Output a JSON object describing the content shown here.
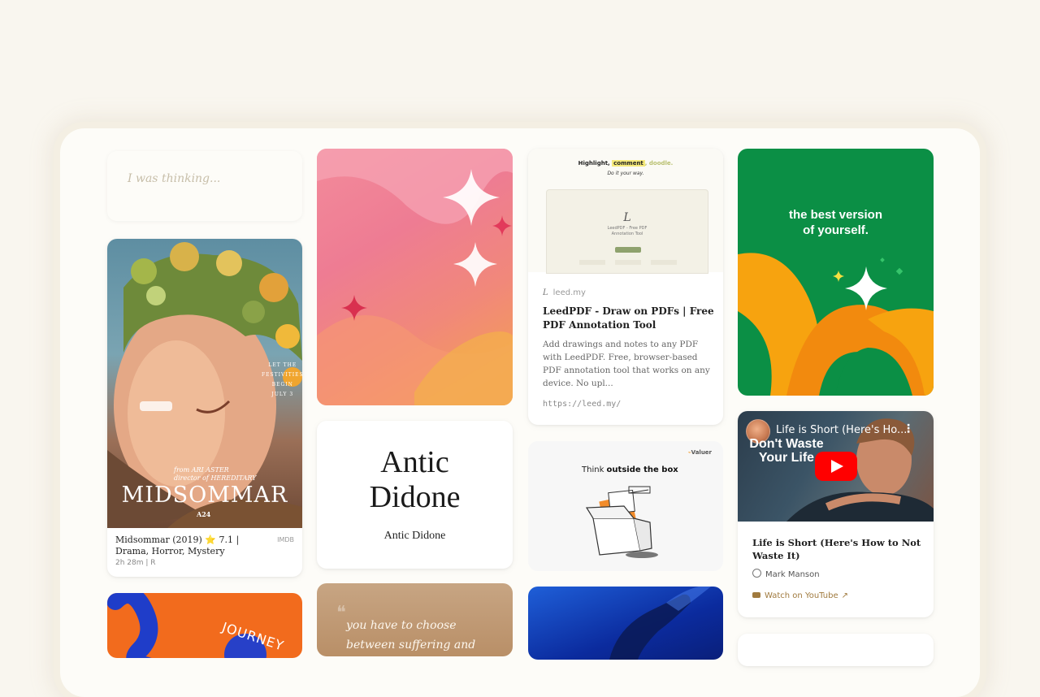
{
  "note": {
    "placeholder": "I was thinking..."
  },
  "movie": {
    "poster_title": "MIDSOMMAR",
    "poster_credit": "from ARI ASTER\ndirector of HEREDITARY",
    "poster_dates": "LET THE\nFESTIVITIES\nBEGIN\nJULY 3",
    "poster_studio": "A24",
    "title_line": "Midsommar (2019) ⭐ 7.1 | Drama, Horror, Mystery",
    "sub_line": "2h 28m | R",
    "source": "IMDB"
  },
  "font_card": {
    "display_text": "Antic\nDidone",
    "name": "Antic Didone"
  },
  "quote": {
    "text": "you have to choose\nbetween suffering and"
  },
  "link_card": {
    "preview_headline_prefix": "Highlight, ",
    "preview_headline_highlight": "comment",
    "preview_headline_suffix": ", doodle.",
    "preview_subline": "Do it your way.",
    "preview_logo": "L",
    "preview_app_title": "LeedPDF - Free PDF\nAnnotation Tool",
    "domain": "leed.my",
    "domain_icon": "L",
    "title": "LeedPDF - Draw on PDFs | Free PDF Annotation Tool",
    "description": "Add drawings and notes to any PDF with LeedPDF. Free, browser-based PDF annotation tool that works on any device. No upl...",
    "url": "https://leed.my/"
  },
  "think_card": {
    "brand": "Valuer",
    "text_prefix": "Think ",
    "text_bold": "outside the box"
  },
  "green_card": {
    "headline": "the best version\nof yourself."
  },
  "video_card": {
    "thumb_title": "Life is Short (Here's Ho...",
    "thumb_caption": "Don't Waste\nYour Life",
    "title": "Life is Short (Here's How to Not Waste It)",
    "author": "Mark Manson",
    "watch_label": "Watch on YouTube",
    "icons": [
      "more-vert-icon",
      "play-icon",
      "person-icon",
      "youtube-icon",
      "external-link-icon"
    ]
  },
  "orange_card": {
    "text": "JOURNEY"
  },
  "colors": {
    "background": "#f9f6ef",
    "green": "#0b8f45",
    "orange": "#f26b1d",
    "youtube_red": "#ff0000",
    "link_accent": "#a07a3e"
  }
}
